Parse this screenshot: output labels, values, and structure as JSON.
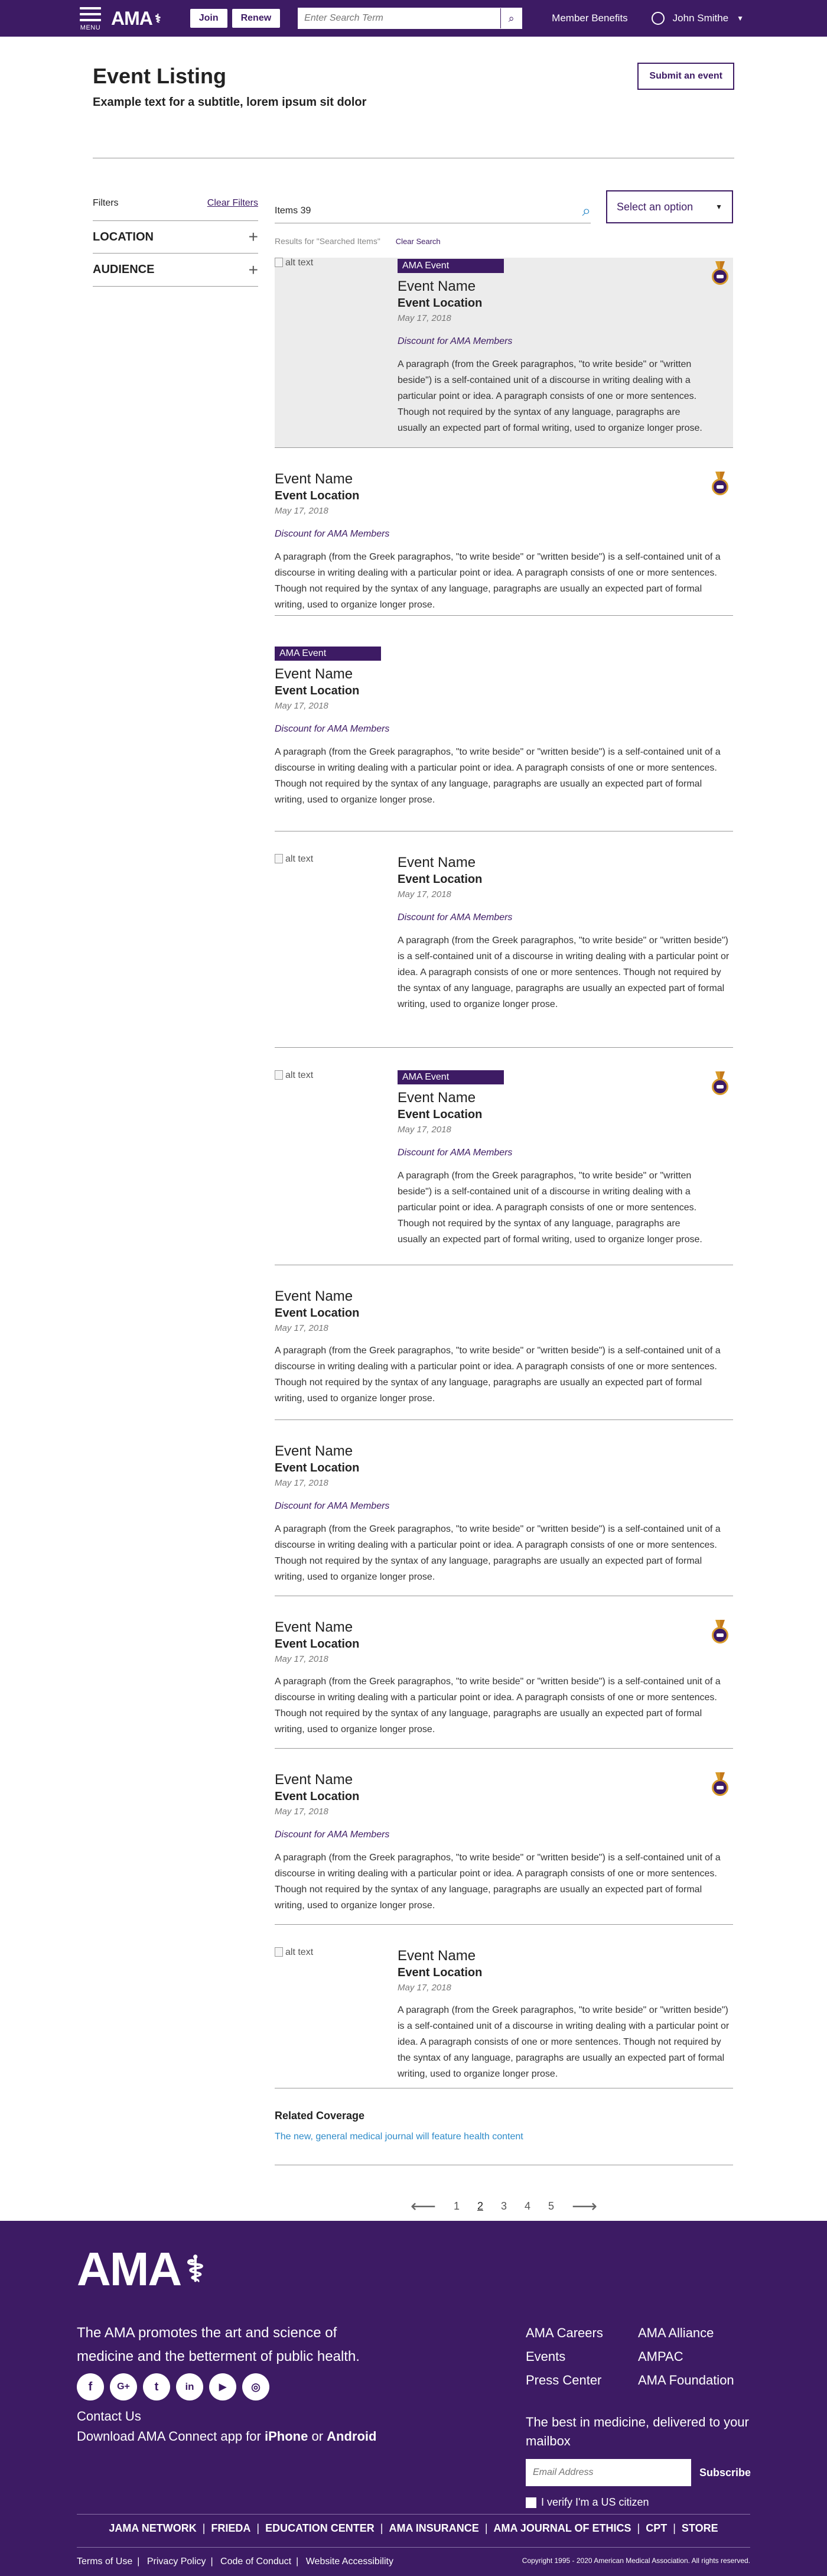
{
  "nav": {
    "menu_label": "MENU",
    "logo": "AMA",
    "join": "Join",
    "renew": "Renew",
    "search_placeholder": "Enter Search Term",
    "member_benefits": "Member Benefits",
    "user_name": "John Smithe"
  },
  "header": {
    "title": "Event Listing",
    "subtitle": "Example text for a subtitle, lorem ipsum sit dolor",
    "submit_label": "Submit an event"
  },
  "filters": {
    "title": "Filters",
    "clear": "Clear Filters",
    "groups": [
      "LOCATION",
      "AUDIENCE"
    ]
  },
  "results": {
    "items_count": "Items 39",
    "select_placeholder": "Select an option",
    "results_for": "Results for \"Searched Items\"",
    "clear_search": "Clear Search"
  },
  "events": [
    {
      "badge": "AMA Event",
      "name": "Event Name",
      "location": "Event Location",
      "date": "May 17, 2018",
      "discount": "Discount for AMA Members",
      "paragraph": "A paragraph (from the Greek paragraphos, \"to write beside\" or \"written beside\") is a self-contained unit of a discourse in writing dealing with a particular point or idea. A paragraph consists of one or more sentences. Though not required by the syntax of any language, paragraphs are usually an expected part of formal writing, used to organize longer prose.",
      "image_alt": "alt text"
    },
    {
      "name": "Event Name",
      "location": "Event Location",
      "date": "May 17, 2018",
      "discount": "Discount for AMA Members",
      "paragraph": "A paragraph (from the Greek paragraphos, \"to write beside\" or \"written beside\") is a self-contained unit of a discourse in writing dealing with a particular point or idea. A paragraph consists of one or more sentences. Though not required by the syntax of any language, paragraphs are usually an expected part of formal writing, used to organize longer prose."
    },
    {
      "badge": "AMA Event",
      "name": "Event Name",
      "location": "Event Location",
      "date": "May 17, 2018",
      "discount": "Discount for AMA Members",
      "paragraph": "A paragraph (from the Greek paragraphos, \"to write beside\" or \"written beside\") is a self-contained unit of a discourse in writing dealing with a particular point or idea. A paragraph consists of one or more sentences. Though not required by the syntax of any language, paragraphs are usually an expected part of formal writing, used to organize longer prose."
    },
    {
      "name": "Event Name",
      "location": "Event Location",
      "date": "May 17, 2018",
      "discount": "Discount for AMA Members",
      "paragraph": "A paragraph (from the Greek paragraphos, \"to write beside\" or \"written beside\") is a self-contained unit of a discourse in writing dealing with a particular point or idea. A paragraph consists of one or more sentences. Though not required by the syntax of any language, paragraphs are usually an expected part of formal writing, used to organize longer prose.",
      "image_alt": "alt text"
    },
    {
      "badge": "AMA Event",
      "name": "Event Name",
      "location": "Event Location",
      "date": "May 17, 2018",
      "discount": "Discount for AMA Members",
      "paragraph": "A paragraph (from the Greek paragraphos, \"to write beside\" or \"written beside\") is a self-contained unit of a discourse in writing dealing with a particular point or idea. A paragraph consists of one or more sentences. Though not required by the syntax of any language, paragraphs are usually an expected part of formal writing, used to organize longer prose.",
      "image_alt": "alt text"
    },
    {
      "name": "Event Name",
      "location": "Event Location",
      "date": "May 17, 2018",
      "paragraph": "A paragraph (from the Greek paragraphos, \"to write beside\" or \"written beside\") is a self-contained unit of a discourse in writing dealing with a particular point or idea. A paragraph consists of one or more sentences. Though not required by the syntax of any language, paragraphs are usually an expected part of formal writing, used to organize longer prose."
    },
    {
      "name": "Event Name",
      "location": "Event Location",
      "date": "May 17, 2018",
      "discount": "Discount for AMA Members",
      "paragraph": "A paragraph (from the Greek paragraphos, \"to write beside\" or \"written beside\") is a self-contained unit of a discourse in writing dealing with a particular point or idea. A paragraph consists of one or more sentences. Though not required by the syntax of any language, paragraphs are usually an expected part of formal writing, used to organize longer prose."
    },
    {
      "name": "Event Name",
      "location": "Event Location",
      "date": "May 17, 2018",
      "paragraph": "A paragraph (from the Greek paragraphos, \"to write beside\" or \"written beside\") is a self-contained unit of a discourse in writing dealing with a particular point or idea. A paragraph consists of one or more sentences. Though not required by the syntax of any language, paragraphs are usually an expected part of formal writing, used to organize longer prose."
    },
    {
      "name": "Event Name",
      "location": "Event Location",
      "date": "May 17, 2018",
      "discount": "Discount for AMA Members",
      "paragraph": "A paragraph (from the Greek paragraphos, \"to write beside\" or \"written beside\") is a self-contained unit of a discourse in writing dealing with a particular point or idea. A paragraph consists of one or more sentences. Though not required by the syntax of any language, paragraphs are usually an expected part of formal writing, used to organize longer prose."
    },
    {
      "name": "Event Name",
      "location": "Event Location",
      "date": "May 17, 2018",
      "paragraph": "A paragraph (from the Greek paragraphos, \"to write beside\" or \"written beside\") is a self-contained unit of a discourse in writing dealing with a particular point or idea. A paragraph consists of one or more sentences. Though not required by the syntax of any language, paragraphs are usually an expected part of formal writing, used to organize longer prose.",
      "image_alt": "alt text"
    }
  ],
  "related": {
    "title": "Related Coverage",
    "link": "The new, general medical journal will feature health content"
  },
  "pager": {
    "pages": [
      "1",
      "2",
      "3",
      "4",
      "5"
    ],
    "active": "2"
  },
  "footer": {
    "logo": "AMA",
    "mission": "The AMA promotes the art and science of medicine and the betterment of public health.",
    "social_icons": [
      "facebook-icon",
      "google-plus-icon",
      "twitter-icon",
      "linkedin-icon",
      "youtube-icon",
      "instagram-icon"
    ],
    "contact": "Contact Us",
    "download_prefix": "Download AMA Connect app for",
    "download_ios": "iPhone",
    "download_or": "or",
    "download_android": "Android",
    "links_col1": [
      "AMA Careers",
      "Events",
      "Press Center"
    ],
    "links_col2": [
      "AMA Alliance",
      "AMPAC",
      "AMA Foundation"
    ],
    "newsletter": "The best in medicine, delivered to your mailbox",
    "email_placeholder": "Email Address",
    "subscribe": "Subscribe",
    "citizen": "I verify I'm a US citizen",
    "nav": [
      "JAMA NETWORK",
      "FRIEDA",
      "EDUCATION CENTER",
      "AMA INSURANCE",
      "AMA JOURNAL OF ETHICS",
      "CPT",
      "STORE"
    ],
    "legal": [
      "Terms of Use",
      "Privacy Policy",
      "Code of Conduct",
      "Website Accessibility"
    ],
    "copyright": "Copyright 1995 - 2020 American Medical Association. All rights reserved."
  }
}
